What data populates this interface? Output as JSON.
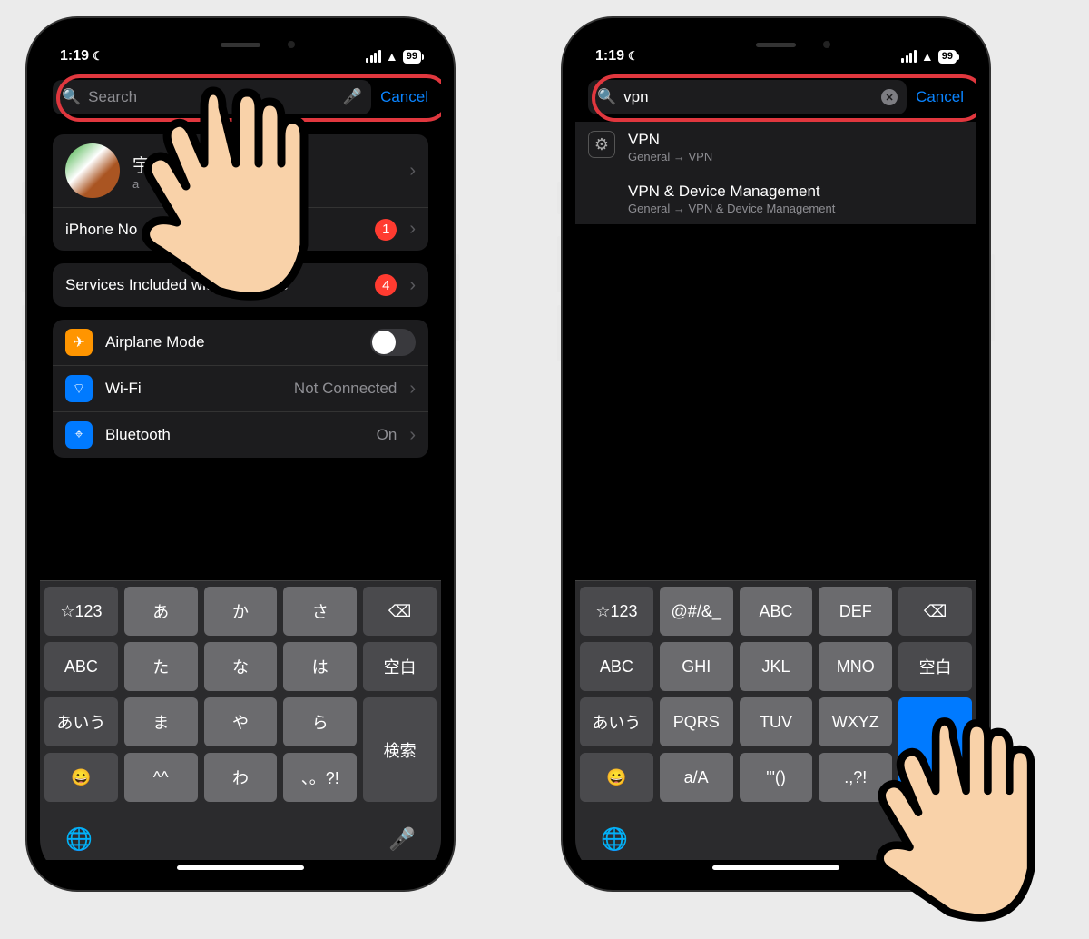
{
  "status": {
    "time": "1:19",
    "battery": "99"
  },
  "left": {
    "search_placeholder": "Search",
    "cancel": "Cancel",
    "profile_top": "宇",
    "profile_sub": "a",
    "row_backup": "iPhone No",
    "badge_backup": "1",
    "row_services": "Services Included with Purchase",
    "badge_services": "4",
    "airplane": "Airplane Mode",
    "wifi": "Wi-Fi",
    "wifi_val": "Not Connected",
    "bt": "Bluetooth",
    "bt_val": "On",
    "keys_row1": [
      "☆123",
      "あ",
      "か",
      "さ",
      "⌫"
    ],
    "keys_row2": [
      "ABC",
      "た",
      "な",
      "は",
      "空白"
    ],
    "keys_row3": [
      "あいう",
      "ま",
      "や",
      "ら",
      "検索"
    ],
    "keys_row4": [
      "😀",
      "^^",
      "わ",
      "、。?!",
      ""
    ]
  },
  "right": {
    "search_value": "vpn",
    "cancel": "Cancel",
    "result1_title": "VPN",
    "result1_path": "General → VPN",
    "result2_title": "VPN & Device Management",
    "result2_path": "General → VPN & Device Management",
    "keys_row1": [
      "☆123",
      "@#/&_",
      "ABC",
      "DEF",
      "⌫"
    ],
    "keys_row2": [
      "ABC",
      "GHI",
      "JKL",
      "MNO",
      "空白"
    ],
    "keys_row3": [
      "あいう",
      "PQRS",
      "TUV",
      "WXYZ",
      ""
    ],
    "keys_row4": [
      "😀",
      "a/A",
      "'\"()",
      ".,?!",
      ""
    ]
  }
}
